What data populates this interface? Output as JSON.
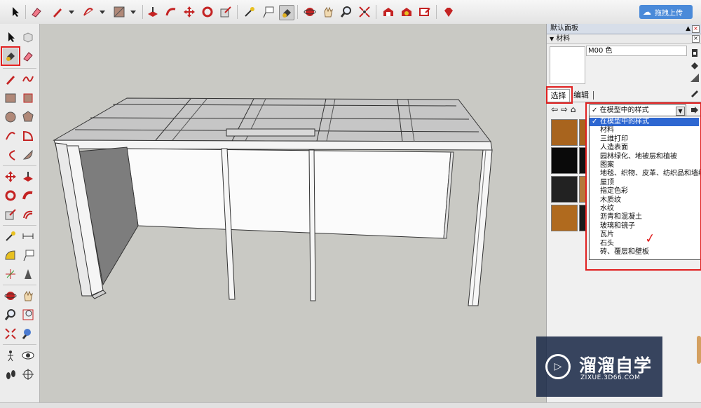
{
  "toolbar": {
    "upload_label": "拖拽上传",
    "icons": [
      "select-arrow-icon",
      "eraser-icon",
      "pencil-icon",
      "arc-icon",
      "shape-icon",
      "pushpull-icon",
      "followme-icon",
      "move-icon",
      "rotate-icon",
      "scale-icon",
      "tape-icon",
      "text-icon",
      "paint-bucket-icon",
      "orbit-icon",
      "pan-icon",
      "zoom-icon",
      "zoom-extents-icon",
      "warehouse-icon",
      "extension-icon",
      "share-icon",
      "ruby-icon"
    ]
  },
  "left_toolbar": {
    "icons": [
      "select-icon",
      "component-icon",
      "paint-bucket-icon",
      "eraser-icon",
      "pencil-icon",
      "freehand-icon",
      "rectangle-icon",
      "rotated-rectangle-icon",
      "circle-icon",
      "polygon-icon",
      "arc-icon",
      "pie-icon",
      "arc3-icon",
      "arc2-icon",
      "move-icon",
      "pushpull-icon",
      "rotate-icon",
      "followme-icon",
      "scale-icon",
      "offset-icon",
      "tape-icon",
      "dimension-icon",
      "protractor-icon",
      "text-icon",
      "axes-icon",
      "3d-text-icon",
      "orbit-icon",
      "pan-icon",
      "zoom-icon",
      "zoom-window-icon",
      "zoom-extents-icon",
      "previous-view-icon",
      "position-camera-icon",
      "look-around-icon",
      "walk-icon",
      "section-plane-icon"
    ]
  },
  "panel": {
    "title": "默认面板",
    "section": "材料",
    "material_name": "M00 色",
    "tab_select": "选择",
    "tab_edit": "编辑",
    "combo_value": "在模型中的样式",
    "dropdown_items": [
      "在模型中的样式",
      "材料",
      "三维打印",
      "人造表面",
      "园林绿化、地被层和植被",
      "图案",
      "地毯、织物、皮革、纺织品和墙纸",
      "屋顶",
      "指定色彩",
      "木质纹",
      "水纹",
      "沥青和混凝土",
      "玻璃和镜子",
      "瓦片",
      "石头",
      "砖、覆层和壁板"
    ],
    "thumb_colors": [
      "#a8641e",
      "#0a0a0a",
      "#222222",
      "#b06a1e"
    ]
  },
  "watermark": {
    "title": "溜溜自学",
    "subtitle": "ZIXUE.3D66.COM"
  },
  "colors": {
    "highlight": "#e02020",
    "selection": "#2e67d1",
    "viewport_bg": "#c9c9c4",
    "upload_btn": "#4a8ad9"
  }
}
